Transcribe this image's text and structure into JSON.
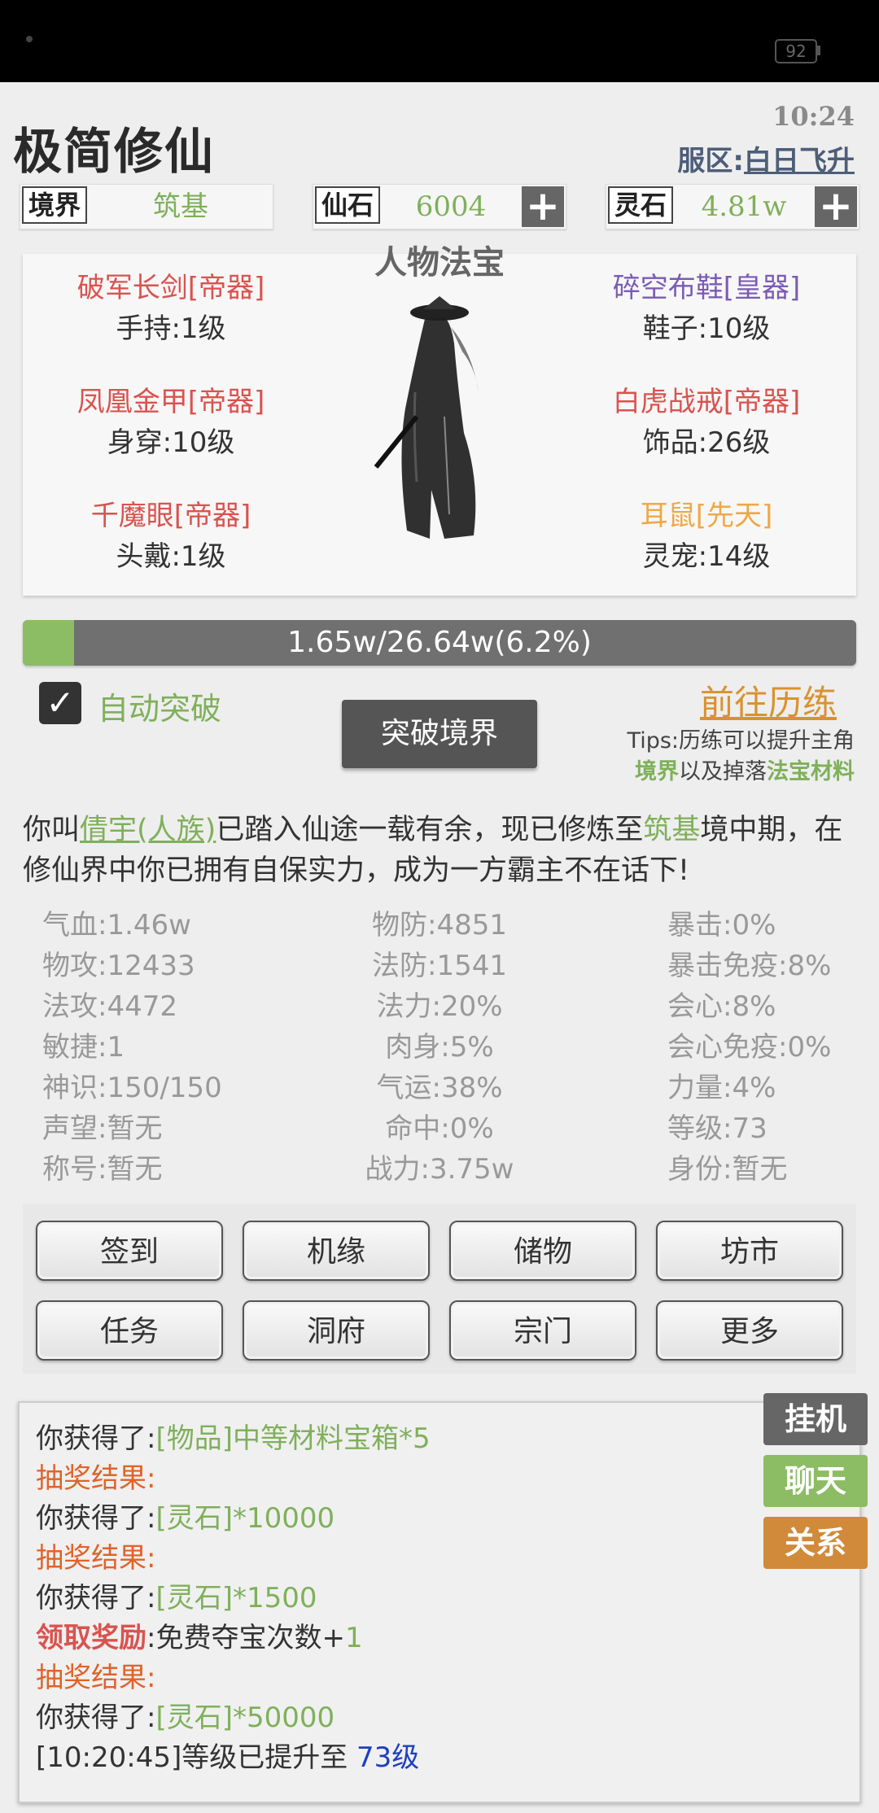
{
  "status_bar": {
    "battery": "92"
  },
  "header": {
    "title": "极简修仙",
    "clock": "10:24",
    "server_label": "服区:",
    "server_value": "白日飞升"
  },
  "resources": [
    {
      "label": "境界",
      "value": "筑基"
    },
    {
      "label": "仙石",
      "value": "6004",
      "action": "+"
    },
    {
      "label": "灵石",
      "value": "4.81w",
      "action": "+"
    }
  ],
  "equipment": {
    "title": "人物法宝",
    "left": [
      {
        "name": "破军长剑[帝器]",
        "slot": "手持:1级"
      },
      {
        "name": "凤凰金甲[帝器]",
        "slot": "身穿:10级"
      },
      {
        "name": "千魔眼[帝器]",
        "slot": "头戴:1级"
      }
    ],
    "right": [
      {
        "name": "碎空布鞋[皇器]",
        "slot": "鞋子:10级"
      },
      {
        "name": "白虎战戒[帝器]",
        "slot": "饰品:26级"
      },
      {
        "name": "耳鼠[先天]",
        "slot": "灵宠:14级"
      }
    ],
    "colors": {
      "red": "#d9534f",
      "purple": "#7a5bb5",
      "gold": "#f0a845"
    }
  },
  "progress": {
    "text": "1.65w/26.64w(6.2%)",
    "fraction": 0.062
  },
  "controls": {
    "auto_break_label": "自动突破",
    "auto_break_checked": true,
    "break_button": "突破境界",
    "go_train_link": "前往历练",
    "tips_prefix": "Tips:历练可以提升主角",
    "tips_realm": "境界",
    "tips_mid": "以及掉落",
    "tips_material": "法宝材料"
  },
  "story": {
    "p1": "你叫",
    "name": "倩宇(人族)",
    "p2": "已踏入仙途一载有余，现已修炼至",
    "realm": "筑基",
    "p3": "境中期，在修仙界中你已拥有自保实力，成为一方霸主不在话下!"
  },
  "stats": {
    "col1": [
      "气血:1.46w",
      "物攻:12433",
      "法攻:4472",
      "敏捷:1",
      "神识:150/150",
      "声望:暂无",
      "称号:暂无"
    ],
    "col2": [
      "物防:4851",
      "法防:1541",
      "法力:20%",
      "肉身:5%",
      "气运:38%",
      "命中:0%",
      "战力:3.75w"
    ],
    "col3": [
      "暴击:0%",
      "暴击免疫:8%",
      "会心:8%",
      "会心免疫:0%",
      "力量:4%",
      "等级:73",
      "身份:暂无"
    ]
  },
  "menu": [
    "签到",
    "机缘",
    "储物",
    "坊市",
    "任务",
    "洞府",
    "宗门",
    "更多"
  ],
  "log": {
    "l1a": "你获得了:",
    "l1b": "[物品]中等材料宝箱*5",
    "l2": "抽奖结果:",
    "l3a": "你获得了:",
    "l3b": "[灵石]*10000",
    "l4": "抽奖结果:",
    "l5a": "你获得了:",
    "l5b": "[灵石]*1500",
    "l6a": "领取奖励",
    "l6b": ":免费夺宝次数+",
    "l6c": "1",
    "l7": "抽奖结果:",
    "l8a": "你获得了:",
    "l8b": "[灵石]*50000",
    "l9a": "[10:20:45]等级已提升至 ",
    "l9b": "73级"
  },
  "side_buttons": [
    {
      "label": "挂机",
      "color": "#666666"
    },
    {
      "label": "聊天",
      "color": "#8cbc64"
    },
    {
      "label": "关系",
      "color": "#d08a3a"
    }
  ]
}
